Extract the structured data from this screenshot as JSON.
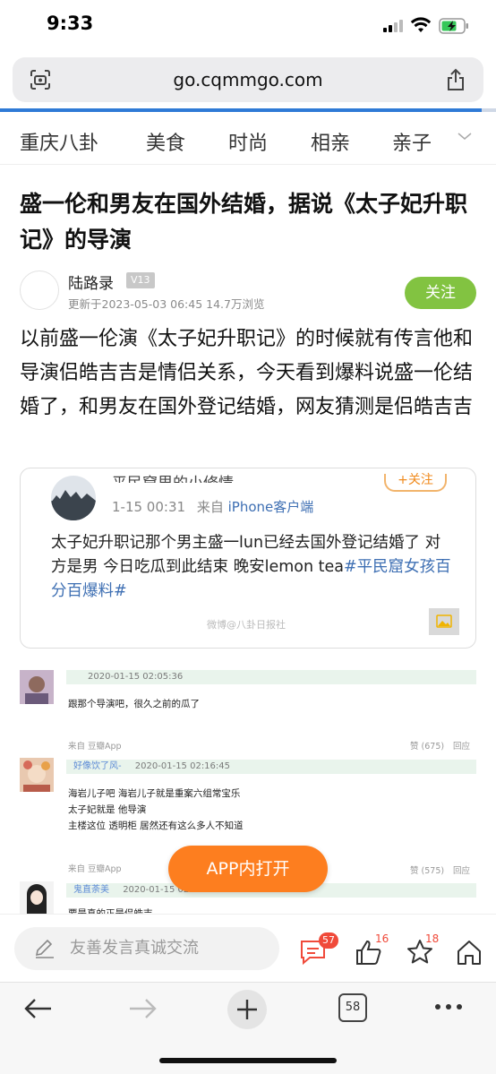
{
  "status": {
    "time": "9:33"
  },
  "browser": {
    "url": "go.cqmmgo.com",
    "tabs_count": "58"
  },
  "nav": {
    "items": [
      "重庆八卦",
      "美食",
      "时尚",
      "相亲",
      "亲子"
    ]
  },
  "article": {
    "title": "盛一伦和男友在国外结婚，据说《太子妃升职记》的导演",
    "author": "陆路录",
    "level": "V13",
    "meta": "更新于2023-05-03 06:45  14.7万浏览",
    "follow_label": "关注",
    "body": "以前盛一伦演《太子妃升职记》的时候就有传言他和导演侣皓吉吉是情侣关系，今天看到爆料说盛一伦结婚了，和男友在国外登记结婚，网友猜测是侣皓吉吉"
  },
  "embed": {
    "name_cut": "平民窟里的小修情",
    "follow_label": "+关注",
    "time": "1-15 00:31",
    "source_prefix": "来自",
    "source": "iPhone客户端",
    "text": "太子妃升职记那个男主盛一lun已经去国外登记结婚了 对方是男 今日吃瓜到此结束 晚安lemon tea",
    "hashtag": "#平民窟女孩百分百爆料#",
    "watermark": "微博@八卦日报社"
  },
  "forum": {
    "posts": [
      {
        "name": "",
        "time": "2020-01-15 02:05:36",
        "lines": [
          "跟那个导演吧，很久之前的瓜了"
        ]
      },
      {
        "source": "来自  豆瓣App",
        "like": "赞 (675)",
        "reply": "回应",
        "name": "好像饮了风-",
        "time": "2020-01-15 02:16:45",
        "lines": [
          "海岩儿子吧 海岩儿子就是重案六组常宝乐",
          "太子妃就是 他导演",
          "主楼这位 透明柜 居然还有这么多人不知道"
        ]
      },
      {
        "source": "来自  豆瓣App",
        "like": "赞 (575)",
        "reply": "回应",
        "name": "鬼直荼美",
        "time": "2020-01-15 02:",
        "lines": [
          "要是真的正是侣皓吉"
        ]
      }
    ]
  },
  "app_open_label": "APP内打开",
  "comment_bar": {
    "placeholder": "友善发言真诚交流",
    "comments": "57",
    "likes": "16",
    "favs": "18"
  },
  "colors": {
    "accent_green": "#82c341",
    "accent_orange": "#fd7e1f",
    "link_blue": "#3e6fb3",
    "badge_red": "#f04a3a"
  }
}
